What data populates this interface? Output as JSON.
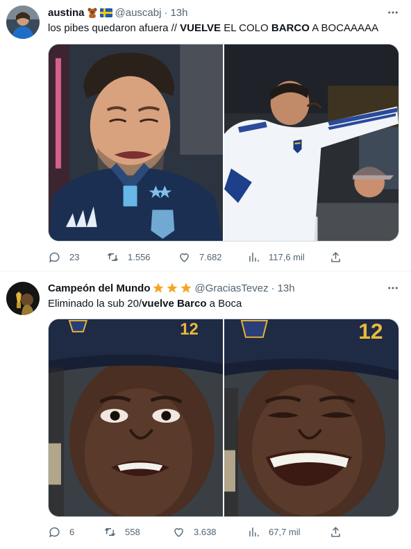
{
  "tweets": [
    {
      "name": "austina",
      "handle": "@auscabj",
      "dot": "·",
      "time": "13h",
      "text_parts": [
        "los pibes quedaron afuera // ",
        "VUELVE",
        " EL COLO ",
        "BARCO",
        " A BOCAAAAA"
      ],
      "stats": {
        "replies": "23",
        "retweets": "1.556",
        "likes": "7.682",
        "views": "117,6 mil"
      }
    },
    {
      "name": "Campeón del Mundo",
      "handle": "@GraciasTevez",
      "dot": "·",
      "time": "13h",
      "text_parts": [
        "Eliminado la sub 20/",
        "vuelve Barco",
        " a Boca"
      ],
      "stats": {
        "replies": "6",
        "retweets": "558",
        "likes": "3.638",
        "views": "67,7 mil"
      }
    }
  ],
  "photo_labels": {
    "jersey_number": "12"
  },
  "icons": {
    "reply": "reply-icon",
    "retweet": "retweet-icon",
    "like": "heart-icon",
    "views": "views-icon",
    "share": "share-icon",
    "more": "more-icon"
  },
  "colors": {
    "text": "#0f1419",
    "secondary": "#536471",
    "border": "#cfd9de",
    "star": "#f5a623"
  }
}
